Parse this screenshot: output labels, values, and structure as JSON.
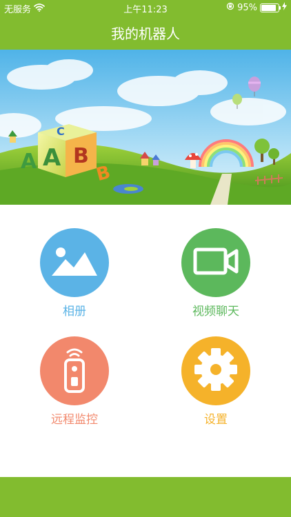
{
  "status_bar": {
    "carrier": "无服务",
    "time": "上午11:23",
    "battery": "95%",
    "battery_level": 0.95
  },
  "navbar": {
    "title": "我的机器人"
  },
  "colors": {
    "brand": "#82bc2f",
    "album": "#5bb3e6",
    "video": "#5cb85c",
    "remote": "#f2886c",
    "settings": "#f5b22a"
  },
  "menu": {
    "album": {
      "label": "相册",
      "icon": "image-icon"
    },
    "video_chat": {
      "label": "视频聊天",
      "icon": "video-camera-icon"
    },
    "remote_monitor": {
      "label": "远程监控",
      "icon": "remote-control-icon"
    },
    "settings": {
      "label": "设置",
      "icon": "gear-icon"
    }
  }
}
